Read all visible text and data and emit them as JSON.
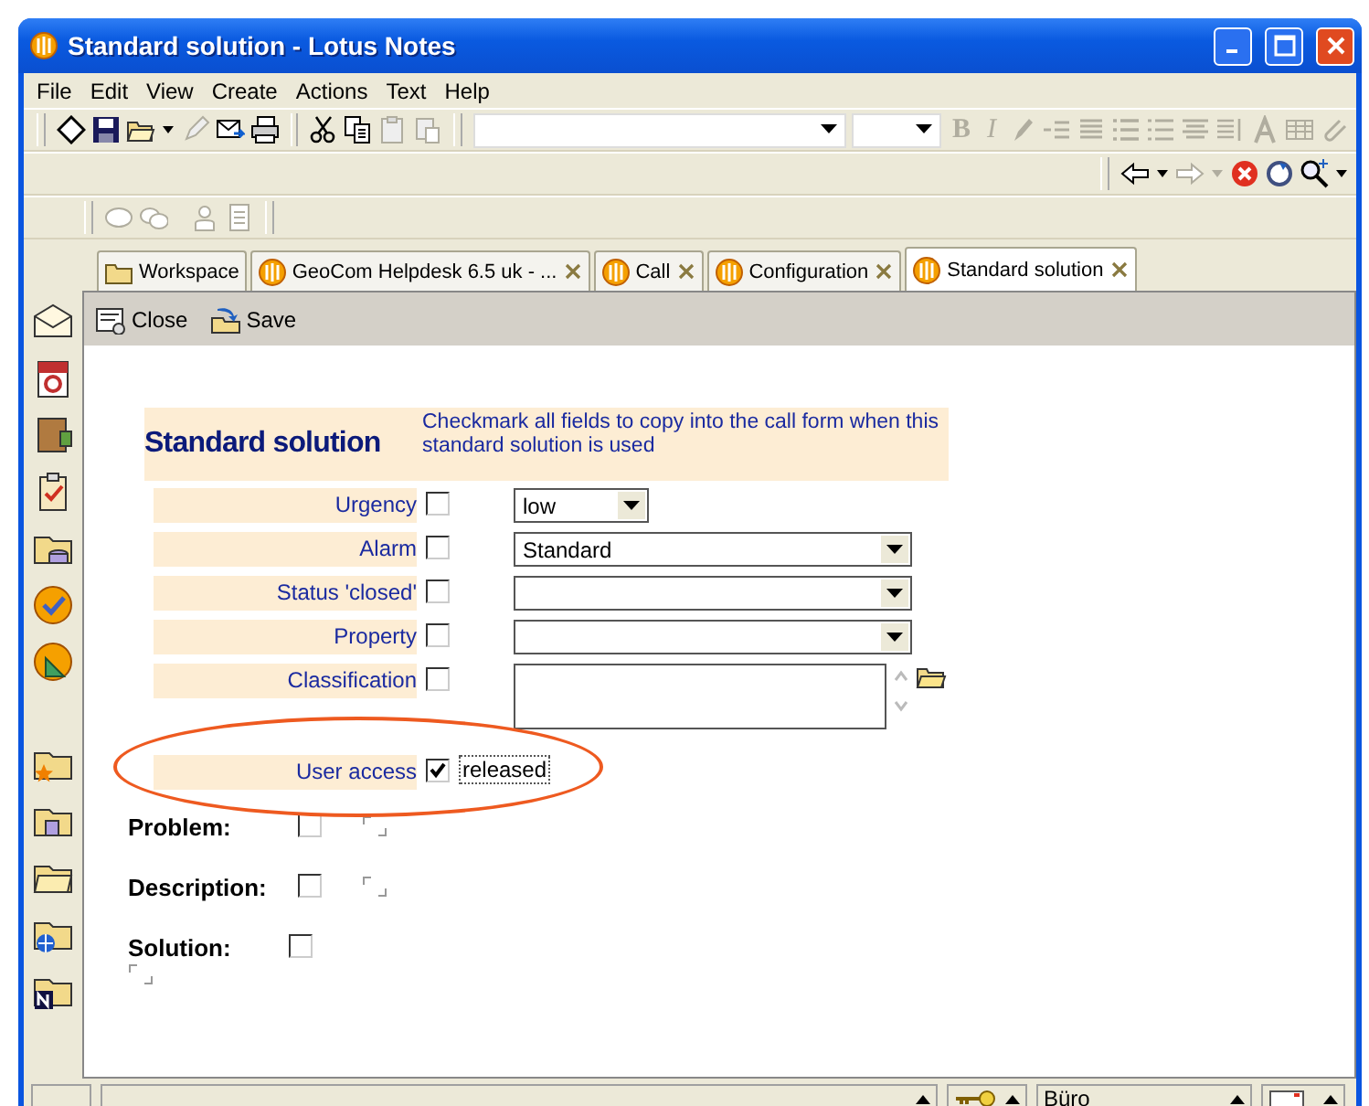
{
  "window": {
    "title": "Standard solution - Lotus Notes"
  },
  "menu": [
    "File",
    "Edit",
    "View",
    "Create",
    "Actions",
    "Text",
    "Help"
  ],
  "format_buttons": [
    {
      "label": "B",
      "disabled": true
    },
    {
      "label": "I",
      "disabled": true
    }
  ],
  "tabs": [
    {
      "label": "Workspace",
      "selected": false,
      "closable": false
    },
    {
      "label": "GeoCom Helpdesk 6.5 uk - ...",
      "selected": false,
      "closable": true
    },
    {
      "label": "Call",
      "selected": false,
      "closable": true
    },
    {
      "label": "Configuration",
      "selected": false,
      "closable": true
    },
    {
      "label": "Standard solution",
      "selected": true,
      "closable": true
    }
  ],
  "actions": [
    "Close",
    "Save"
  ],
  "form": {
    "title": "Standard solution",
    "hint": "Checkmark all fields to copy into the call form when this standard solution is used",
    "fields": [
      {
        "label": "Urgency",
        "checked": false,
        "kind": "small-combo",
        "value": "low"
      },
      {
        "label": "Alarm",
        "checked": false,
        "kind": "combo",
        "value": "Standard"
      },
      {
        "label": "Status 'closed'",
        "checked": false,
        "kind": "combo"
      },
      {
        "label": "Property",
        "checked": false,
        "kind": "combo"
      },
      {
        "label": "Classification",
        "checked": false,
        "kind": "multiline"
      }
    ],
    "user_access": {
      "label": "User access",
      "checked": true,
      "value": "released",
      "circled": true
    },
    "rich_fields": [
      {
        "label": "Problem:",
        "checked": false
      },
      {
        "label": "Description:",
        "checked": false
      },
      {
        "label": "Solution:",
        "checked": false
      }
    ]
  },
  "status_bar": {
    "location": "Büro"
  }
}
